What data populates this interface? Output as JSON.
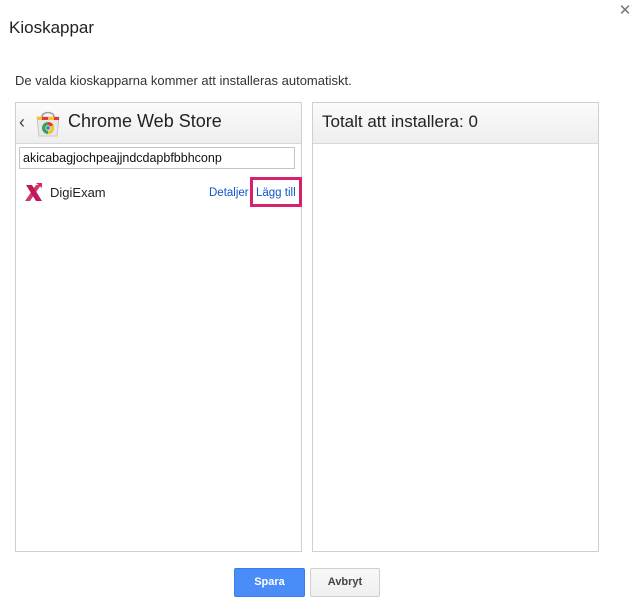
{
  "dialog": {
    "title": "Kioskappar",
    "close_icon": "close-icon",
    "description": "De valda kioskapparna kommer att installeras automatiskt."
  },
  "left_panel": {
    "back_icon": "chevron-left-icon",
    "store_icon": "chrome-web-store-icon",
    "store_title": "Chrome Web Store",
    "search_value": "akicabagjochpeajjndcdapbfbbhconp",
    "apps": [
      {
        "name": "DigiExam",
        "icon": "digiexam-icon",
        "details_label": "Detaljer",
        "add_label": "Lägg till",
        "highlight_color": "#d4236a"
      }
    ]
  },
  "right_panel": {
    "title": "Totalt att installera: 0"
  },
  "footer": {
    "save_label": "Spara",
    "cancel_label": "Avbryt"
  },
  "colors": {
    "primary": "#4b8df8",
    "link": "#1155cc",
    "brand_digiexam": "#c2185b"
  }
}
